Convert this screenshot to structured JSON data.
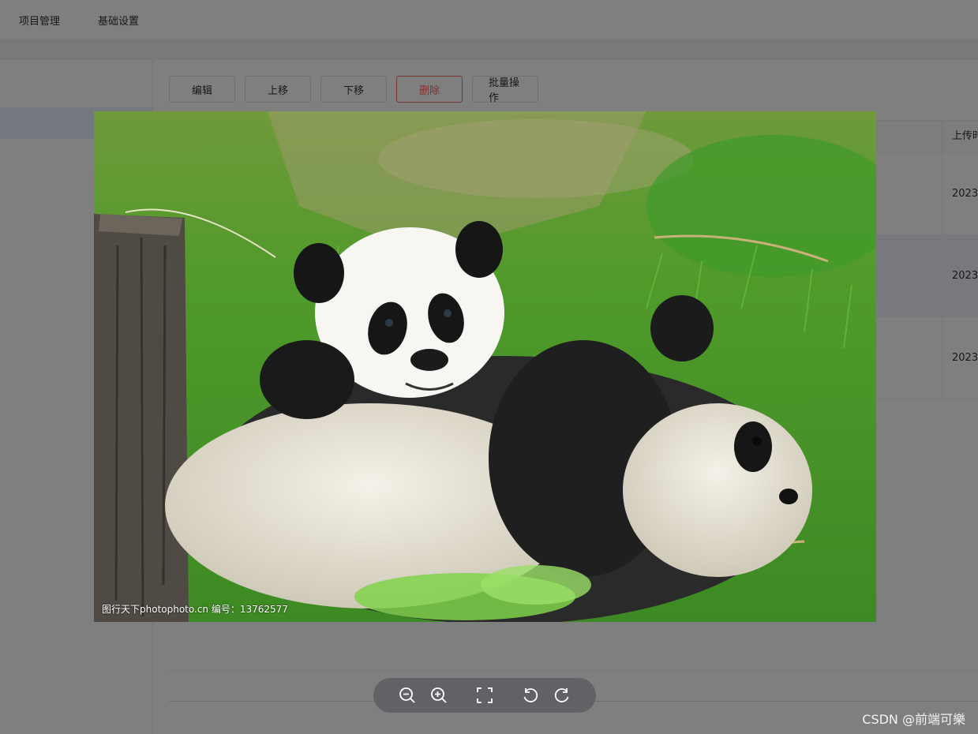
{
  "topnav": {
    "items": [
      {
        "label": "项目管理"
      },
      {
        "label": "基础设置"
      }
    ]
  },
  "toolbar": {
    "edit_label": "编辑",
    "move_up_label": "上移",
    "move_down_label": "下移",
    "delete_label": "删除",
    "batch_label": "批量操作"
  },
  "table": {
    "last_column_header": "上传时",
    "rows": [
      {
        "date": "2023"
      },
      {
        "date": "2023"
      },
      {
        "date": "2023"
      }
    ]
  },
  "viewer": {
    "caption": "图行天下photophoto.cn  编号：13762577",
    "actions": [
      "zoom-out",
      "zoom-in",
      "fullscreen",
      "rotate-left",
      "rotate-right"
    ]
  },
  "watermark": "CSDN @前端可樂",
  "colors": {
    "danger": "#f56c6c",
    "overlay": "rgba(0,0,0,0.5)",
    "toolbar_bg": "#606266"
  }
}
